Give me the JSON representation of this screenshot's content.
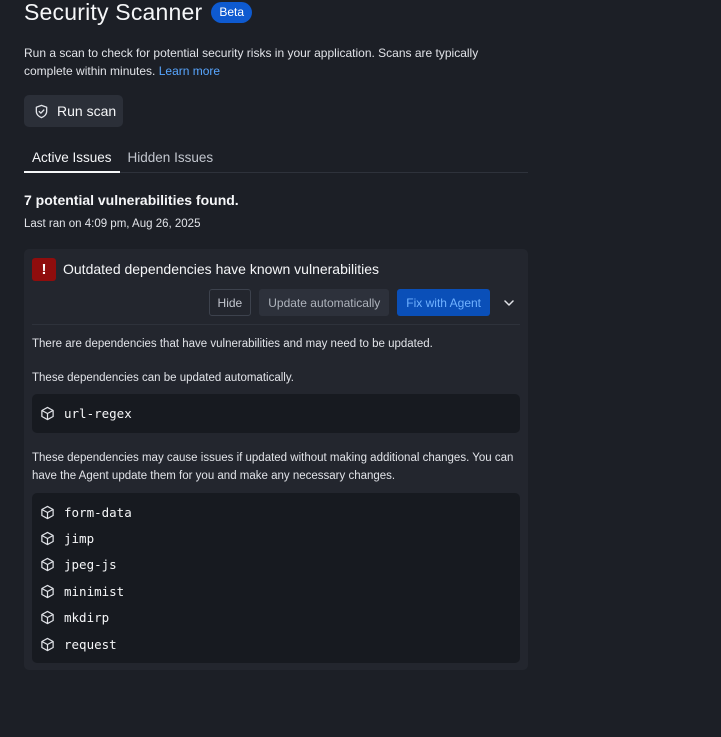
{
  "header": {
    "title": "Security Scanner",
    "badge": "Beta"
  },
  "description": {
    "text": "Run a scan to check for potential security risks in your application. Scans are typically complete within minutes.",
    "link": "Learn more"
  },
  "run_button": {
    "label": "Run scan",
    "icon": "shield-icon"
  },
  "tabs": [
    {
      "label": "Active Issues",
      "active": true
    },
    {
      "label": "Hidden Issues",
      "active": false
    }
  ],
  "summary": {
    "found": "7 potential vulnerabilities found.",
    "last_ran": "Last ran on 4:09 pm, Aug 26, 2025"
  },
  "issue": {
    "icon": "exclamation-icon",
    "title": "Outdated dependencies have known vulnerabilities",
    "actions": {
      "hide": "Hide",
      "update": "Update automatically",
      "fix": "Fix with Agent"
    },
    "intro": "There are dependencies that have vulnerabilities and may need to be updated.",
    "auto_text": "These dependencies can be updated automatically.",
    "auto_packages": [
      "url-regex"
    ],
    "manual_text": "These dependencies may cause issues if updated without making additional changes. You can have the Agent update them for you and make any necessary changes.",
    "manual_packages": [
      "form-data",
      "jimp",
      "jpeg-js",
      "minimist",
      "mkdirp",
      "request"
    ]
  },
  "colors": {
    "background": "#1c1f26",
    "card": "#23262e",
    "accent_blue": "#0a4fb8",
    "link": "#58a6ff",
    "danger": "#8f0d0d"
  }
}
